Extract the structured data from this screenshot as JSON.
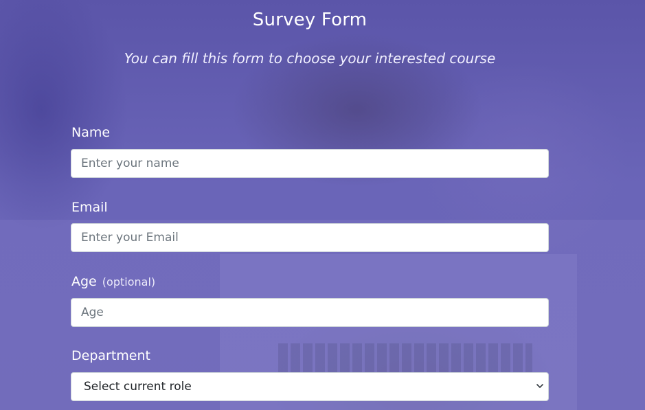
{
  "header": {
    "title": "Survey Form",
    "subtitle": "You can fill this form to choose your interested course"
  },
  "form": {
    "name": {
      "label": "Name",
      "placeholder": "Enter your name",
      "value": ""
    },
    "email": {
      "label": "Email",
      "placeholder": "Enter your Email",
      "value": ""
    },
    "age": {
      "label": "Age",
      "optional_text": "(optional)",
      "placeholder": "Age",
      "value": ""
    },
    "department": {
      "label": "Department",
      "selected": "Select current role",
      "icon": "chevron-down-icon"
    }
  },
  "colors": {
    "background": "#5b55a9",
    "text": "#ffffff",
    "field_background": "#ffffff",
    "field_border": "#ced4da",
    "placeholder": "#6c757d"
  }
}
